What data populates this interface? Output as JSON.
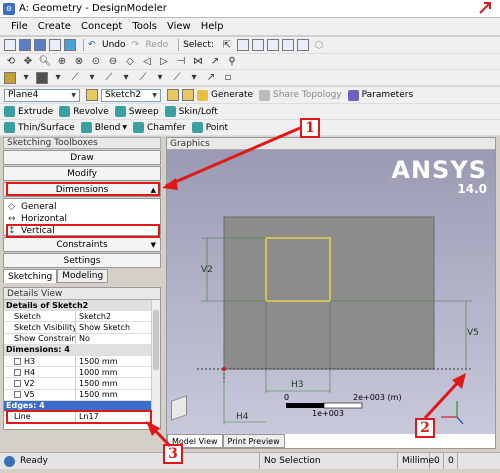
{
  "window": {
    "title": "A: Geometry - DesignModeler"
  },
  "menus": [
    "File",
    "Create",
    "Concept",
    "Tools",
    "View",
    "Help"
  ],
  "toolbar1": {
    "undo": "Undo",
    "redo": "Redo",
    "select_label": "Select:"
  },
  "toolbar3": {
    "plane": "Plane4",
    "sketch": "Sketch2",
    "generate": "Generate",
    "share_topology": "Share Topology",
    "parameters": "Parameters"
  },
  "toolbar4": {
    "extrude": "Extrude",
    "revolve": "Revolve",
    "sweep": "Sweep",
    "skin_loft": "Skin/Loft"
  },
  "toolbar5": {
    "thin_surface": "Thin/Surface",
    "blend": "Blend",
    "chamfer": "Chamfer",
    "point": "Point"
  },
  "toolboxes": {
    "header": "Sketching Toolboxes",
    "draw": "Draw",
    "modify": "Modify",
    "dimensions": "Dimensions",
    "tools": [
      {
        "icon": "general-icon",
        "label": "General"
      },
      {
        "icon": "horizontal-icon",
        "label": "Horizontal"
      },
      {
        "icon": "vertical-icon",
        "label": "Vertical"
      }
    ],
    "constraints": "Constraints",
    "settings": "Settings",
    "tab_sketching": "Sketching",
    "tab_modeling": "Modeling"
  },
  "details": {
    "header": "Details View",
    "group_title": "Details of Sketch2",
    "rows": [
      {
        "k": "Sketch",
        "v": "Sketch2"
      },
      {
        "k": "Sketch Visibility",
        "v": "Show Sketch"
      },
      {
        "k": "Show Constraints?",
        "v": "No"
      }
    ],
    "dims_title": "Dimensions: 4",
    "dims": [
      {
        "k": "H3",
        "v": "1500 mm"
      },
      {
        "k": "H4",
        "v": "1000 mm"
      },
      {
        "k": "V2",
        "v": "1500 mm"
      },
      {
        "k": "V5",
        "v": "1500 mm"
      }
    ],
    "edges_title": "Edges: 4",
    "edge_row": {
      "k": "Line",
      "v": "Ln17"
    }
  },
  "graphics": {
    "header": "Graphics",
    "brand": "ANSYS",
    "version": "14.0",
    "labels": {
      "v2": "V2",
      "v5": "V5",
      "h3": "H3",
      "h4": "H4"
    },
    "scale": {
      "zero": "0",
      "mid": "1e+003",
      "end": "2e+003 (m)"
    },
    "tab_model": "Model View",
    "tab_print": "Print Preview"
  },
  "annotations": {
    "n1": "1",
    "n2": "2",
    "n3": "3"
  },
  "status": {
    "ready": "Ready",
    "selection": "No Selection",
    "units": "Millime",
    "v1": "0",
    "v2": "0"
  },
  "colors": {
    "accent_red": "#e01818",
    "selection_blue": "#3c6ec8",
    "sketch_yellow": "#f0e040"
  }
}
